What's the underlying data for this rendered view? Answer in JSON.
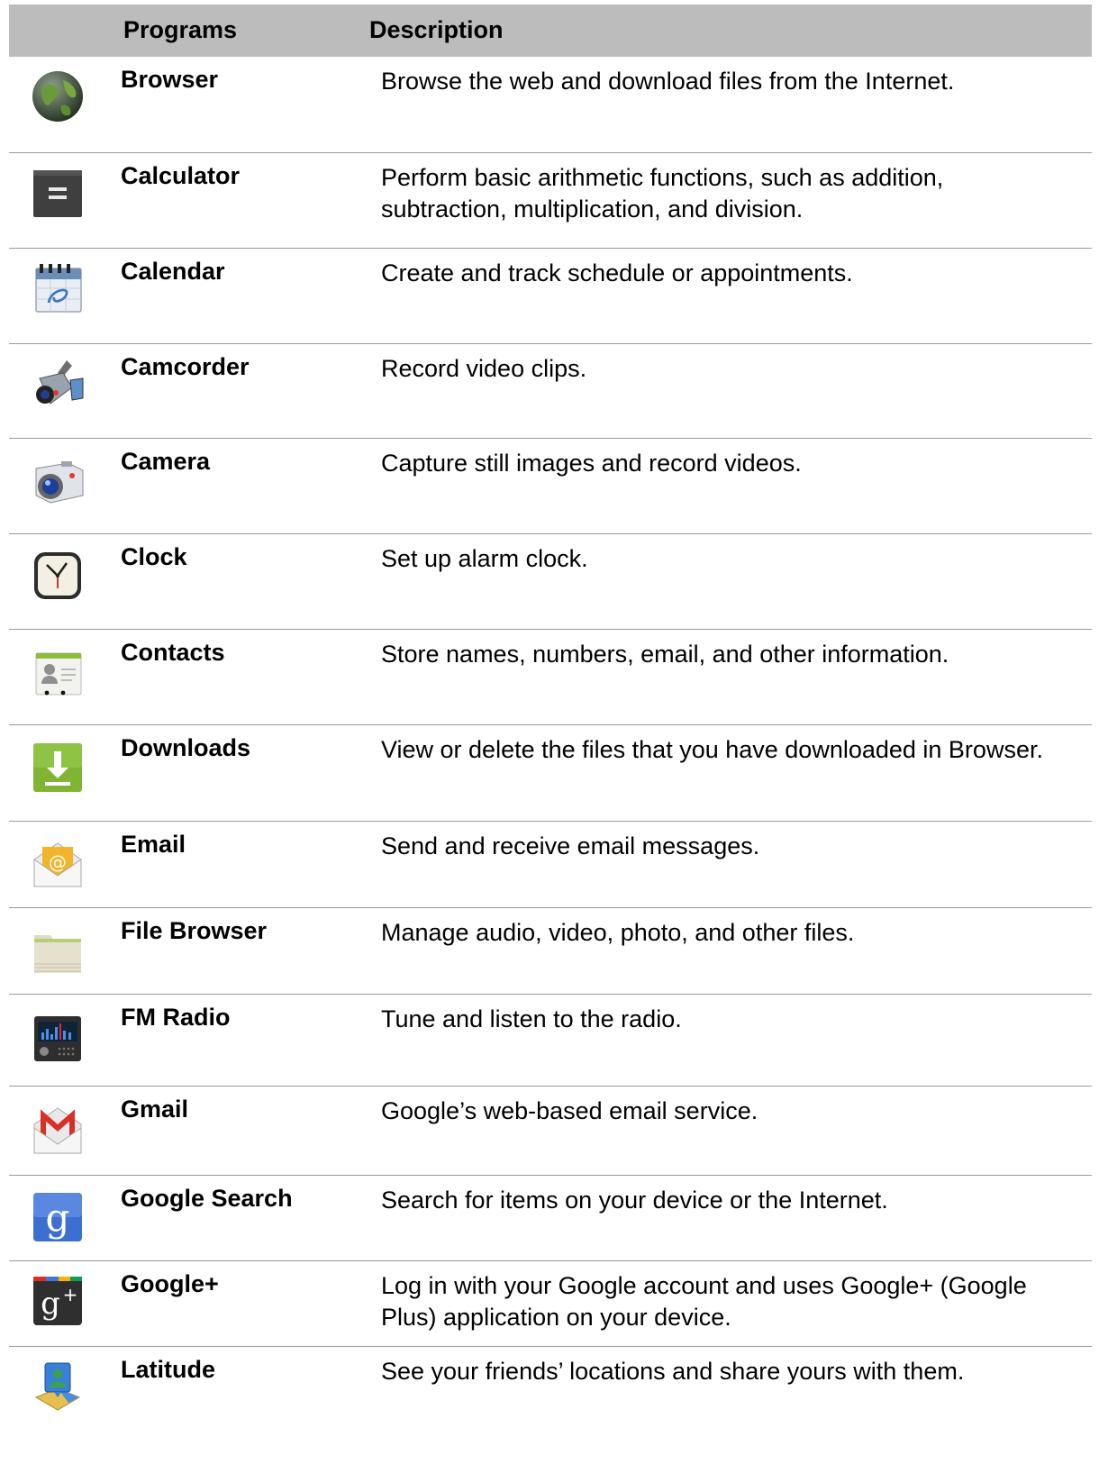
{
  "headers": {
    "programs": "Programs",
    "description": "Description"
  },
  "rows": [
    {
      "name": "Browser",
      "description": "Browse the web and download files from the Internet.",
      "icon": "browser-globe-icon"
    },
    {
      "name": "Calculator",
      "description": "Perform basic arithmetic functions, such as addition, subtraction, multiplication, and division.",
      "icon": "calculator-icon"
    },
    {
      "name": "Calendar",
      "description": "Create and track schedule or appointments.",
      "icon": "calendar-icon"
    },
    {
      "name": "Camcorder",
      "description": "Record video clips.",
      "icon": "camcorder-icon"
    },
    {
      "name": "Camera",
      "description": "Capture still images and record videos.",
      "icon": "camera-icon"
    },
    {
      "name": "Clock",
      "description": "Set up alarm clock.",
      "icon": "clock-icon"
    },
    {
      "name": "Contacts",
      "description": "Store names, numbers, email, and other information.",
      "icon": "contacts-icon"
    },
    {
      "name": "Downloads",
      "description": "View or delete the files that you have downloaded in Browser.",
      "icon": "downloads-icon"
    },
    {
      "name": "Email",
      "description": "Send and receive email messages.",
      "icon": "email-icon"
    },
    {
      "name": "File Browser",
      "description": "Manage audio, video, photo, and other files.",
      "icon": "folder-icon"
    },
    {
      "name": "FM Radio",
      "description": "Tune and listen to the radio.",
      "icon": "radio-icon"
    },
    {
      "name": "Gmail",
      "description": "Google’s web-based email service.",
      "icon": "gmail-icon"
    },
    {
      "name": "Google Search",
      "description": "Search for items on your device or the Internet.",
      "icon": "google-search-icon"
    },
    {
      "name": "Google+",
      "description": "Log in with your Google account and uses Google+ (Google Plus) application on your device.",
      "icon": "google-plus-icon"
    },
    {
      "name": "Latitude",
      "description": "See your friends’ locations and share yours with them.",
      "icon": "latitude-icon"
    }
  ]
}
